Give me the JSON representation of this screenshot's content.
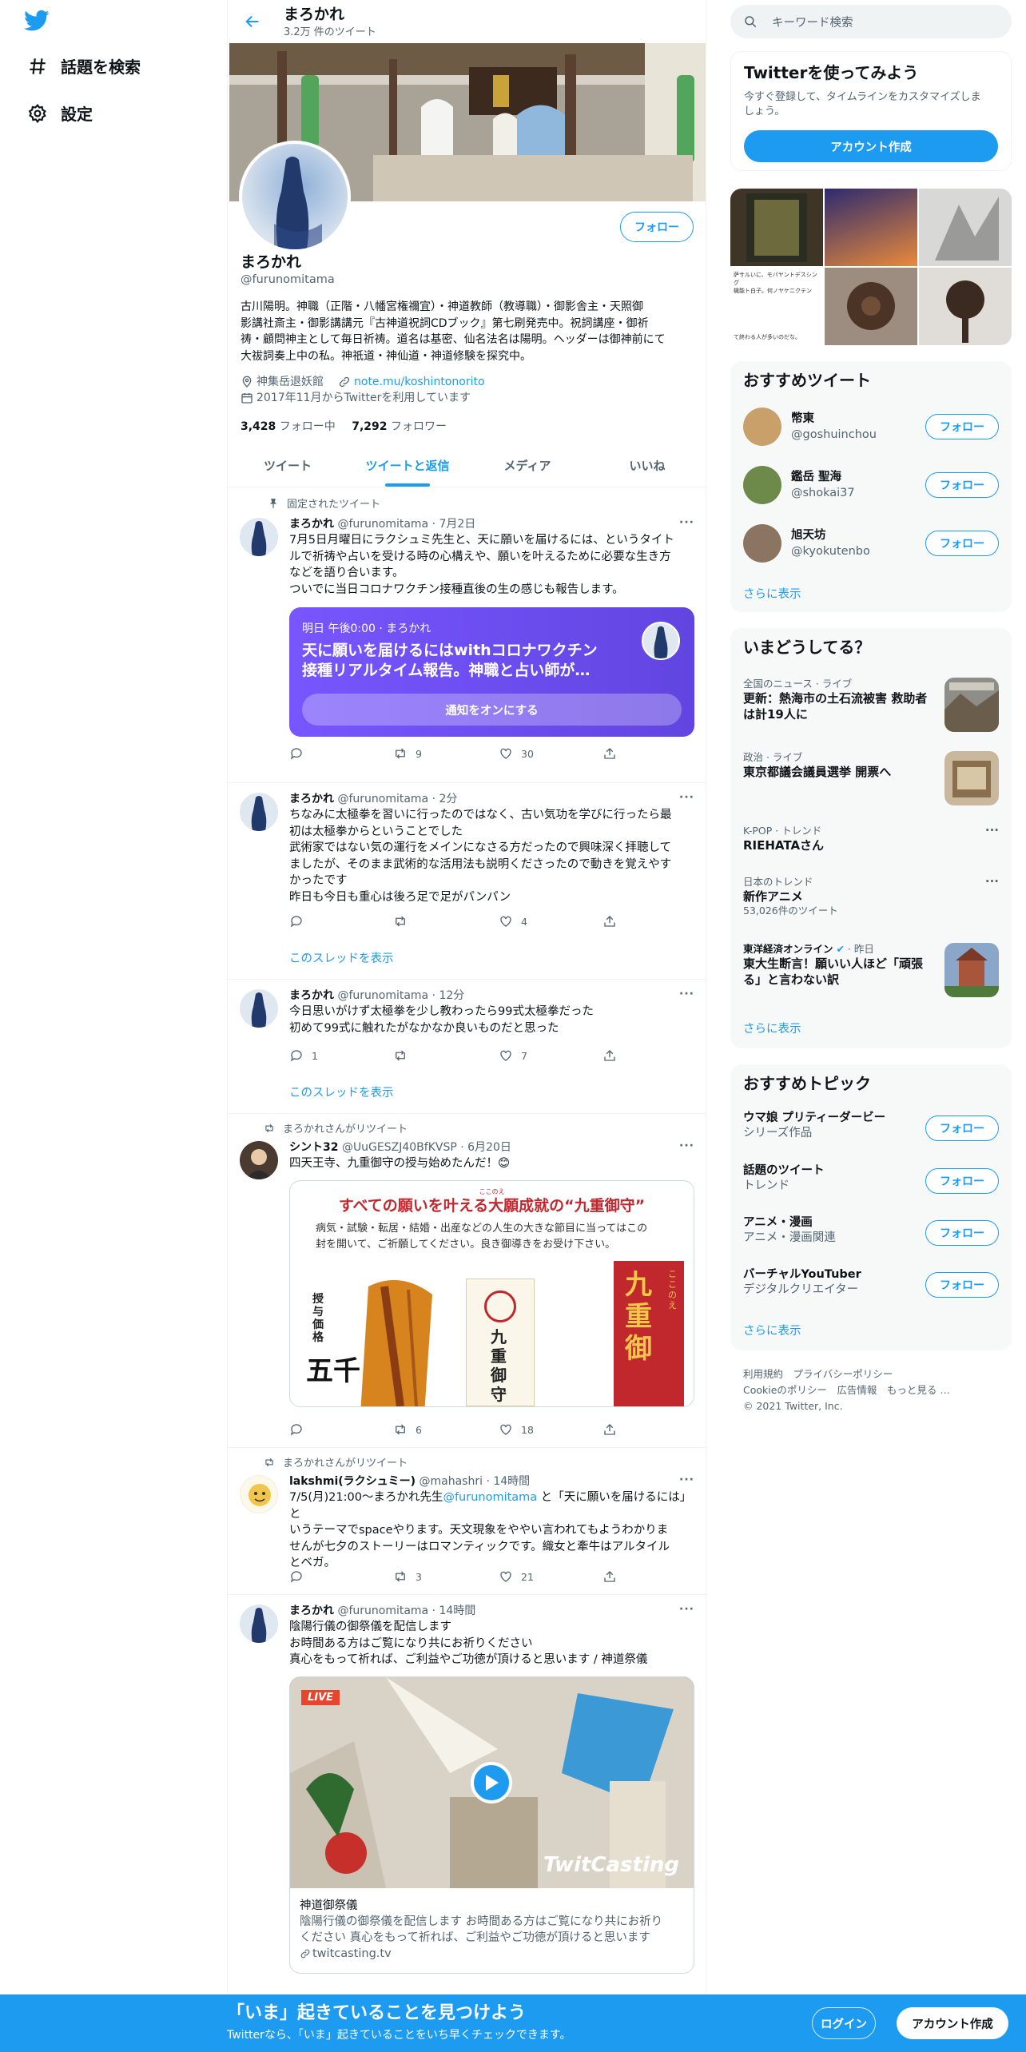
{
  "nav": {
    "items": [
      {
        "label": "話題を検索"
      },
      {
        "label": "設定"
      }
    ]
  },
  "header": {
    "name": "まろかれ",
    "tweet_count": "3.2万 件のツイート"
  },
  "profile": {
    "name": "まろかれ",
    "handle": "@furunomitama",
    "follow_label": "フォロー",
    "bio_lines": [
      "古川陽明。神職（正階・八幡宮権禰宜）・神道教師（教導職）・御影舎主・天照御",
      "影講社斎主・御影講講元『古神道祝詞CDブック』第七刷発売中。祝詞講座・御祈",
      "祷・顧問神主として毎日祈祷。道名は基密、仙名法名は陽明。ヘッダーは御神前にて",
      "大祓詞奏上中の私。神祇道・神仙道・神道修験を探究中。"
    ],
    "location": "神集岳退妖館",
    "link": "note.mu/koshintonorito",
    "joined": "2017年11月からTwitterを利用しています",
    "following_count": "3,428",
    "following_label": "フォロー中",
    "followers_count": "7,292",
    "followers_label": "フォロワー"
  },
  "tabs": [
    {
      "label": "ツイート"
    },
    {
      "label": "ツイートと返信"
    },
    {
      "label": "メディア"
    },
    {
      "label": "いいね"
    }
  ],
  "tweets": [
    {
      "context": "固定されたツイート",
      "name": "まろかれ",
      "handle": "@furunomitama",
      "time": "· 7月2日",
      "lines": [
        "7月5日月曜日にラクシュミ先生と、天に願いを届けるには、というタイト",
        "ルで祈祷や占いを受ける時の心構えや、願いを叶えるために必要な生き方",
        "などを語り合います。",
        "ついでに当日コロナワクチン接種直後の生の感じも報告します。"
      ],
      "space": {
        "when": "明日 午後0:00 · まろかれ",
        "title1": "天に願いを届けるにはwithコロナワクチン",
        "title2": "接種リアルタイム報告。神職と占い師が…",
        "button": "通知をオンにする"
      },
      "retweets": "9",
      "likes": "30"
    },
    {
      "name": "まろかれ",
      "handle": "@furunomitama",
      "time": "· 2分",
      "lines": [
        "ちなみに太極拳を習いに行ったのではなく、古い気功を学びに行ったら最",
        "初は太極拳からということでした",
        "武術家ではない気の運行をメインになさる方だったので興味深く拝聴して",
        "ましたが、そのまま武術的な活用法も説明くださったので動きを覚えやす",
        "かったです",
        "昨日も今日も重心は後ろ足で足がパンパン"
      ],
      "replies": "",
      "retweets": "",
      "likes": "4",
      "thread": "このスレッドを表示"
    },
    {
      "name": "まろかれ",
      "handle": "@furunomitama",
      "time": "· 12分",
      "lines": [
        "今日思いがけず太極拳を少し教わったら99式太極拳だった",
        "初めて99式に触れたがなかなか良いものだと思った"
      ],
      "replies": "1",
      "retweets": "",
      "likes": "7",
      "thread": "このスレッドを表示"
    },
    {
      "context": "まろかれさんがリツイート",
      "name": "シント32",
      "handle": "@UuGESZJ40BfKVSP",
      "time": "· 6月20日",
      "lines": [
        "四天王寺、九重御守の授与始めたんだ！😊"
      ],
      "image": {
        "headline": "すべての願いを叶える大願成就の“九重御守”",
        "ruby": "ここのえ",
        "body1": "病気・試験・転居・結婚・出産などの人生の大きな節目に当ってはこの",
        "body2": "封を開いて、ご祈願してください。良き御導きをお受け下さい。",
        "price": "授与価格",
        "big": "五千",
        "amulet": "九重御守",
        "sign1": "九重御",
        "sign2": "ここのえ"
      },
      "retweets": "6",
      "likes": "18"
    },
    {
      "context": "まろかれさんがリツイート",
      "name": "lakshmi(ラクシュミー)",
      "handle": "@mahashri",
      "time": "· 14時間",
      "line1a": "7/5(月)21:00〜まろかれ先生",
      "line1link": "@furunomitama",
      "line1b": " と「天に願いを届けるには」と",
      "lines": [
        "いうテーマでspaceやります。天文現象をややい言われてもようわかりま",
        "せんが七夕のストーリーはロマンティックです。織女と牽牛はアルタイル",
        "とベガ。"
      ],
      "retweets": "3",
      "likes": "21"
    },
    {
      "name": "まろかれ",
      "handle": "@furunomitama",
      "time": "· 14時間",
      "lines": [
        "陰陽行儀の御祭儀を配信します",
        "お時間ある方はご覧になり共にお祈りください",
        "真心をもって祈れば、ご利益やご功徳が頂けると思います / 神道祭儀"
      ],
      "card": {
        "live": "LIVE",
        "brand": "TwitCasting",
        "title": "神道御祭儀",
        "desc1": "陰陽行儀の御祭儀を配信します お時間ある方はご覧になり共にお祈り",
        "desc2": "ください 真心をもって祈れば、ご利益やご功徳が頂けると思います",
        "domain": "twitcasting.tv"
      }
    }
  ],
  "right": {
    "search_placeholder": "キーワード検索",
    "signup": {
      "title": "Twitterを使ってみよう",
      "desc1": "今すぐ登録して、タイムラインをカスタマイズしま",
      "desc2": "しょう。",
      "button": "アカウント作成"
    },
    "media_caption": {
      "line1": "萨サルいに、モバヤントデスシング",
      "line2": "機能ト白子。何ノヤケニクテン",
      "line3": "て終わる人が多いのだな。"
    },
    "who_to_follow": {
      "title": "おすすめツイート",
      "users": [
        {
          "name": "幣東",
          "handle": "@goshuinchou",
          "button": "フォロー"
        },
        {
          "name": "鑑岳 聖海",
          "handle": "@shokai37",
          "button": "フォロー"
        },
        {
          "name": "旭天坊",
          "handle": "@kyokutenbo",
          "button": "フォロー"
        }
      ],
      "more": "さらに表示"
    },
    "trends": {
      "title": "いまどうしてる？",
      "items": [
        {
          "cat": "全国のニュース · ライブ",
          "name1": "更新：熱海市の土石流被害 救助者",
          "name2": "は計19人に"
        },
        {
          "cat": "政治 · ライブ",
          "name1": "東京都議会議員選挙 開票へ",
          "name2": ""
        },
        {
          "cat": "K-POP · トレンド",
          "name1": "RIEHATAさん",
          "name2": ""
        },
        {
          "cat": "日本のトレンド",
          "name1": "新作アニメ",
          "name2": "",
          "count": "53,026件のツイート"
        },
        {
          "cat": "東洋経済オンライン",
          "time": "· 昨日",
          "name1": "東大生断言！願いい人ほど「頑張",
          "name2": "る」と言わない訳"
        }
      ],
      "more": "さらに表示"
    },
    "topics": {
      "title": "おすすめトピック",
      "items": [
        {
          "name": "ウマ娘 プリティーダービー",
          "sub": "シリーズ作品",
          "button": "フォロー"
        },
        {
          "name": "話題のツイート",
          "sub": "トレンド",
          "button": "フォロー"
        },
        {
          "name": "アニメ・漫画",
          "sub": "アニメ・漫画関連",
          "button": "フォロー"
        },
        {
          "name": "バーチャルYouTuber",
          "sub": "デジタルクリエイター",
          "button": "フォロー"
        }
      ],
      "more": "さらに表示"
    },
    "footer": {
      "line1": "利用規約　プライバシーポリシー",
      "line2": "Cookieのポリシー　広告情報　もっと見る …",
      "line3": "© 2021 Twitter, Inc."
    }
  },
  "bottom": {
    "title": "「いま」起きていることを見つけよう",
    "sub": "Twitterなら、「いま」起きていることをいち早くチェックできます。",
    "login": "ログイン",
    "signup": "アカウント作成"
  }
}
